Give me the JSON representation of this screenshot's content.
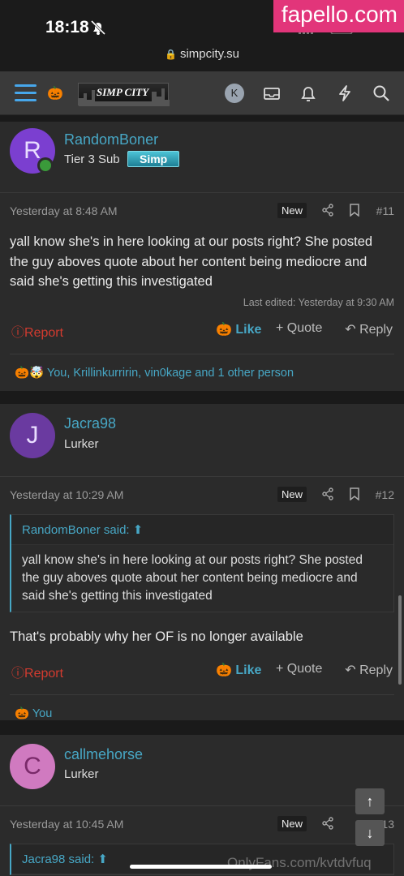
{
  "status": {
    "time": "18:18"
  },
  "watermark": "fapello.com",
  "url": "simpcity.su",
  "nav": {
    "logo": "SIMP CITY",
    "avatar_letter": "K"
  },
  "posts": [
    {
      "author": "RandomBoner",
      "avatar_letter": "R",
      "avatar_color": "#7b3fd0",
      "title": "Tier 3 Sub",
      "badge": "Simp",
      "date": "Yesterday at 8:48 AM",
      "new": "New",
      "number": "#11",
      "text": "yall know she's in here looking at our posts right? She posted the guy aboves quote about her content being mediocre and said she's getting this investigated",
      "edited": "Last edited: Yesterday at 9:30 AM",
      "report": "Report",
      "like": "Like",
      "quote": "+ Quote",
      "reply": "Reply",
      "reactions": "You, Krillinkurririn, vin0kage and 1 other person"
    },
    {
      "author": "Jacra98",
      "avatar_letter": "J",
      "avatar_color": "#6a3aa0",
      "title": "Lurker",
      "date": "Yesterday at 10:29 AM",
      "new": "New",
      "number": "#12",
      "quote_author": "RandomBoner said:",
      "quote_text": "yall know she's in here looking at our posts right? She posted the guy aboves quote about her content being mediocre and said she's getting this investigated",
      "text": "That's probably why her OF is no longer available",
      "report": "Report",
      "like": "Like",
      "quote": "+ Quote",
      "reply": "Reply",
      "reactions": "You"
    },
    {
      "author": "callmehorse",
      "avatar_letter": "C",
      "avatar_color": "#d07ac0",
      "title": "Lurker",
      "date": "Yesterday at 10:45 AM",
      "new": "New",
      "number": "#13",
      "quote_author": "Jacra98 said:"
    }
  ],
  "bottom_watermark": "OnlyFans.com/kvtdvfuq",
  "colors": {
    "accent": "#47a7c5",
    "report": "#d23b2f"
  }
}
